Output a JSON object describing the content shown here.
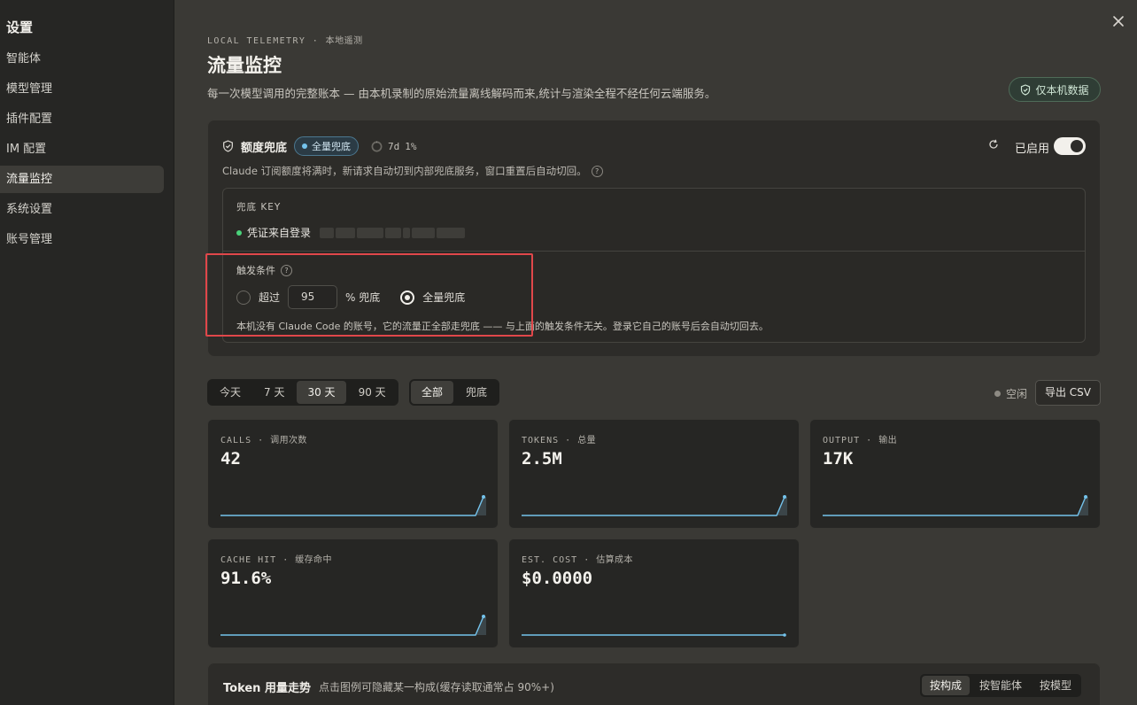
{
  "sidebar": {
    "title": "设置",
    "items": [
      {
        "label": "智能体",
        "active": false
      },
      {
        "label": "模型管理",
        "active": false
      },
      {
        "label": "插件配置",
        "active": false
      },
      {
        "label": "IM 配置",
        "active": false
      },
      {
        "label": "流量监控",
        "active": true
      },
      {
        "label": "系统设置",
        "active": false
      },
      {
        "label": "账号管理",
        "active": false
      }
    ]
  },
  "header": {
    "eyebrow_en": "LOCAL TELEMETRY",
    "eyebrow_sep": "·",
    "eyebrow_cn": "本地遥测",
    "title": "流量监控",
    "description": "每一次模型调用的完整账本 — 由本机录制的原始流量离线解码而来,统计与渲染全程不经任何云端服务。",
    "badge": "仅本机数据"
  },
  "fallback": {
    "label": "额度兜底",
    "mode_pill": "全量兜底",
    "usage_period": "7d",
    "usage_percent": "1%",
    "enabled_label": "已启用",
    "enabled": true,
    "description": "Claude 订阅额度将满时，新请求自动切到内部兜底服务，窗口重置后自动切回。",
    "key_label": "兜底 KEY",
    "credential_text": "凭证来自登录",
    "trigger_label": "触发条件",
    "option_exceed_label": "超过",
    "threshold_value": "95",
    "threshold_suffix": "% 兜底",
    "option_full_label": "全量兜底",
    "selected_option": "full",
    "note": "本机没有 Claude Code 的账号，它的流量正全部走兜底 —— 与上面的触发条件无关。登录它自己的账号后会自动切回去。"
  },
  "filters": {
    "ranges": [
      "今天",
      "7 天",
      "30 天",
      "90 天"
    ],
    "selected_range": "30 天",
    "scopes": [
      "全部",
      "兜底"
    ],
    "selected_scope": "全部",
    "status": "空闲",
    "export_label": "导出 CSV"
  },
  "metrics": [
    {
      "title_en": "CALLS",
      "title_cn": "调用次数",
      "value": "42"
    },
    {
      "title_en": "TOKENS",
      "title_cn": "总量",
      "value": "2.5M"
    },
    {
      "title_en": "OUTPUT",
      "title_cn": "输出",
      "value": "17K"
    },
    {
      "title_en": "CACHE HIT",
      "title_cn": "缓存命中",
      "value": "91.6%"
    },
    {
      "title_en": "EST. COST",
      "title_cn": "估算成本",
      "value": "$0.0000"
    }
  ],
  "token_trend": {
    "title": "Token 用量走势",
    "hint": "点击图例可隐藏某一构成(缓存读取通常占 90%+)",
    "tabs": [
      "按构成",
      "按智能体",
      "按模型"
    ],
    "selected_tab": "按构成"
  },
  "colors": {
    "accent_line": "#74c3ec",
    "enabled_green": "#4ad27a",
    "highlight_red": "#e0474a"
  }
}
